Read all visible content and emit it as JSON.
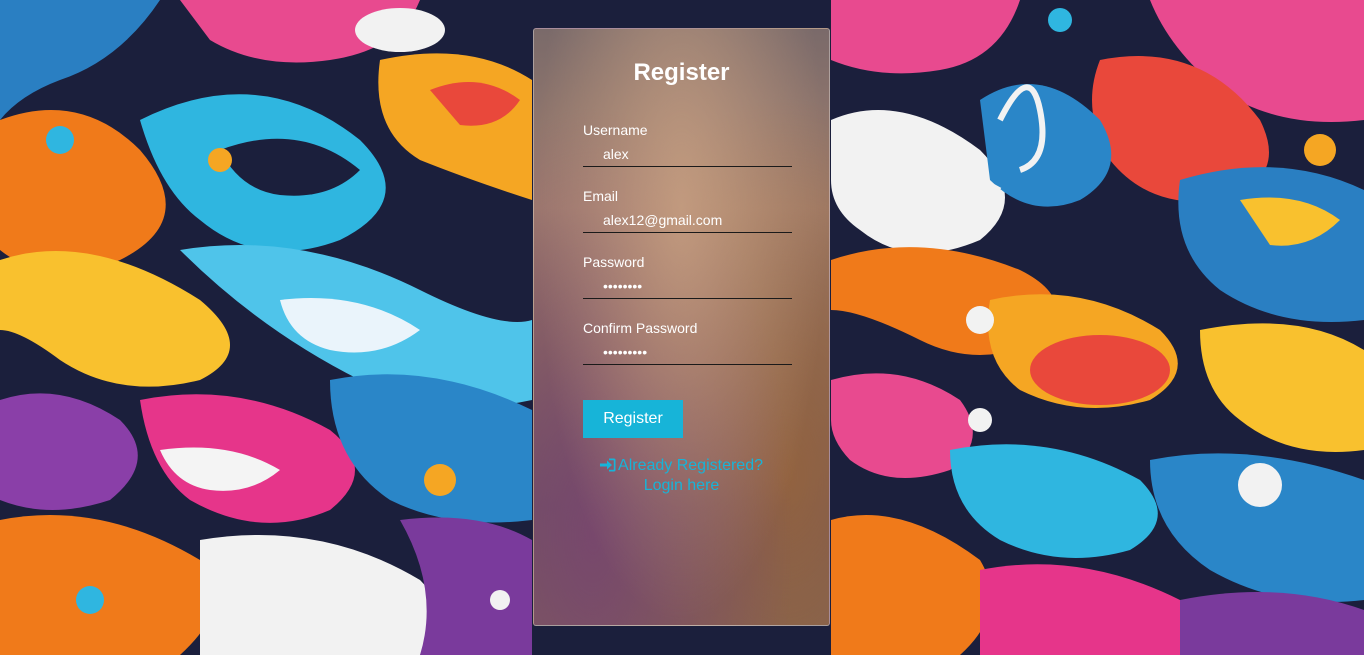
{
  "form": {
    "title": "Register",
    "fields": [
      {
        "label": "Username",
        "value": "alex",
        "type": "text"
      },
      {
        "label": "Email",
        "value": "alex12@gmail.com",
        "type": "text"
      },
      {
        "label": "Password",
        "value": "12345678",
        "type": "password"
      },
      {
        "label": "Confirm Password",
        "value": "123456789",
        "type": "password"
      }
    ],
    "submit_label": "Register",
    "login_link": {
      "icon": "sign-in-icon",
      "line1": "Already Registered?",
      "line2": "Login here"
    }
  },
  "colors": {
    "accent": "#17b4d8",
    "text": "#ffffff"
  }
}
